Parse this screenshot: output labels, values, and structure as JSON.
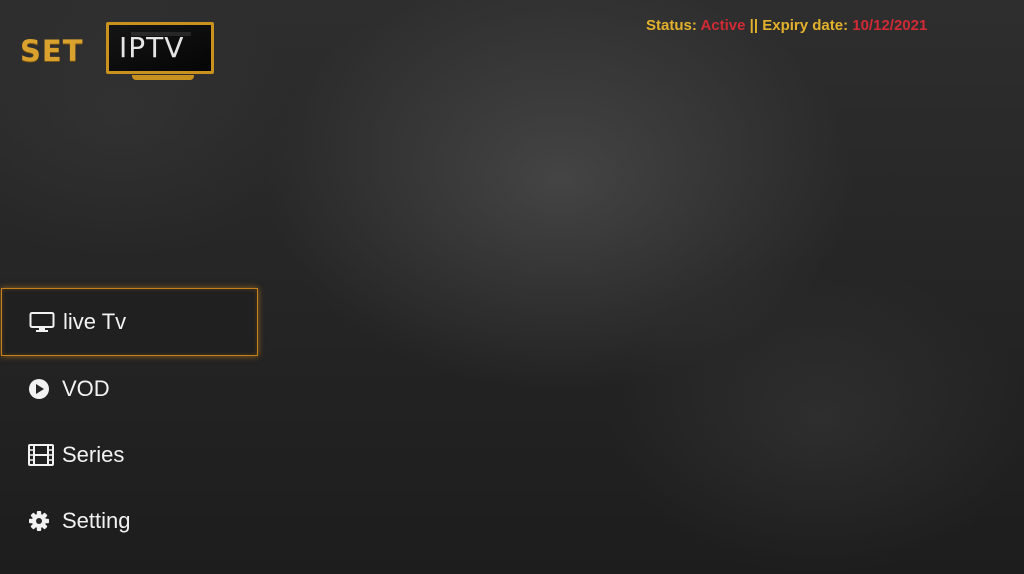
{
  "logo": {
    "part1": "SET",
    "part2": "IPTV"
  },
  "status": {
    "status_label": "Status: ",
    "status_value": "Active",
    "separator": " || ",
    "expiry_label": "Expiry date: ",
    "expiry_value": "10/12/2021"
  },
  "menu": {
    "items": [
      {
        "label": "live Tv",
        "icon": "tv-icon",
        "selected": true
      },
      {
        "label": "VOD",
        "icon": "play-circle-icon",
        "selected": false
      },
      {
        "label": "Series",
        "icon": "film-icon",
        "selected": false
      },
      {
        "label": "Setting",
        "icon": "gear-icon",
        "selected": false
      }
    ]
  },
  "colors": {
    "accent_gold": "#e3b12b",
    "status_red": "#d02a35",
    "focus_border": "#c57f1d"
  }
}
